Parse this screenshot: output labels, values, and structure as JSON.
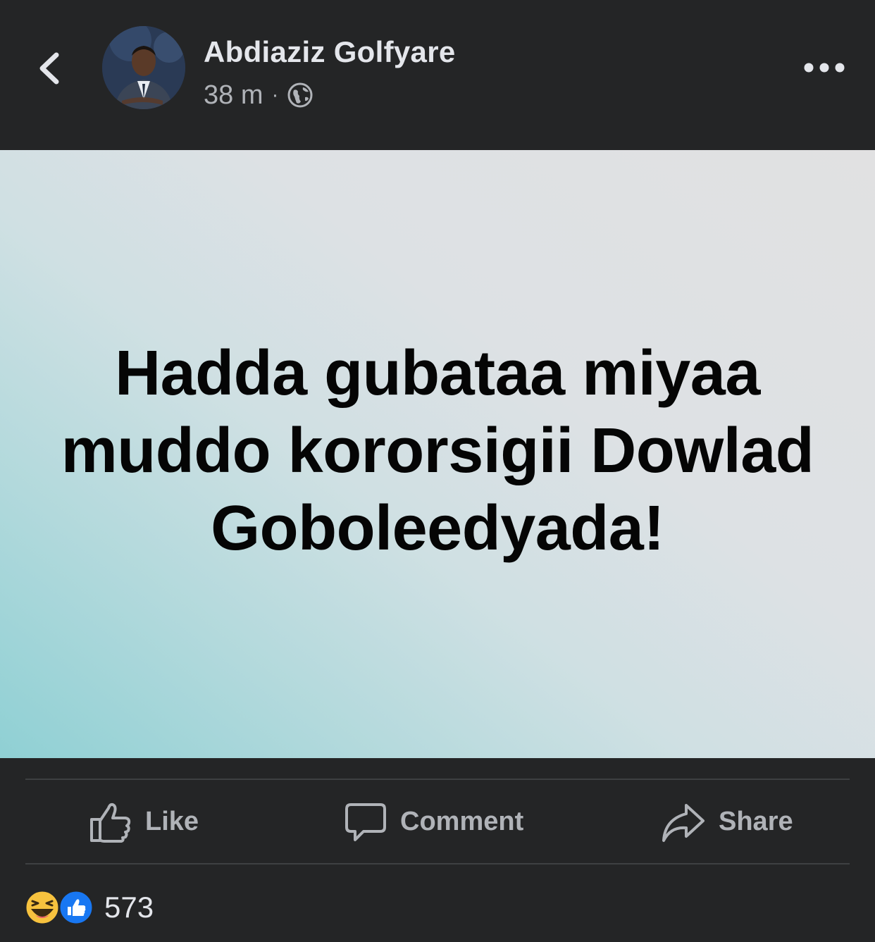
{
  "post": {
    "author_name": "Abdiaziz Golfyare",
    "time": "38 m",
    "meta_separator": "·",
    "privacy_icon": "globe-icon",
    "body_text": "Hadda gubataa miyaa muddo kororsigii Dowlad Goboleedyada!"
  },
  "header": {
    "back_icon": "chevron-left-icon",
    "more_icon": "more-horizontal-icon"
  },
  "actions": {
    "like_label": "Like",
    "comment_label": "Comment",
    "share_label": "Share"
  },
  "reactions": {
    "types": [
      "haha",
      "like"
    ],
    "count": "573"
  },
  "colors": {
    "background": "#242526",
    "text_primary": "#e4e6eb",
    "text_secondary": "#b0b3b8",
    "like_blue": "#1877f2",
    "haha_yellow": "#f7c23e"
  }
}
